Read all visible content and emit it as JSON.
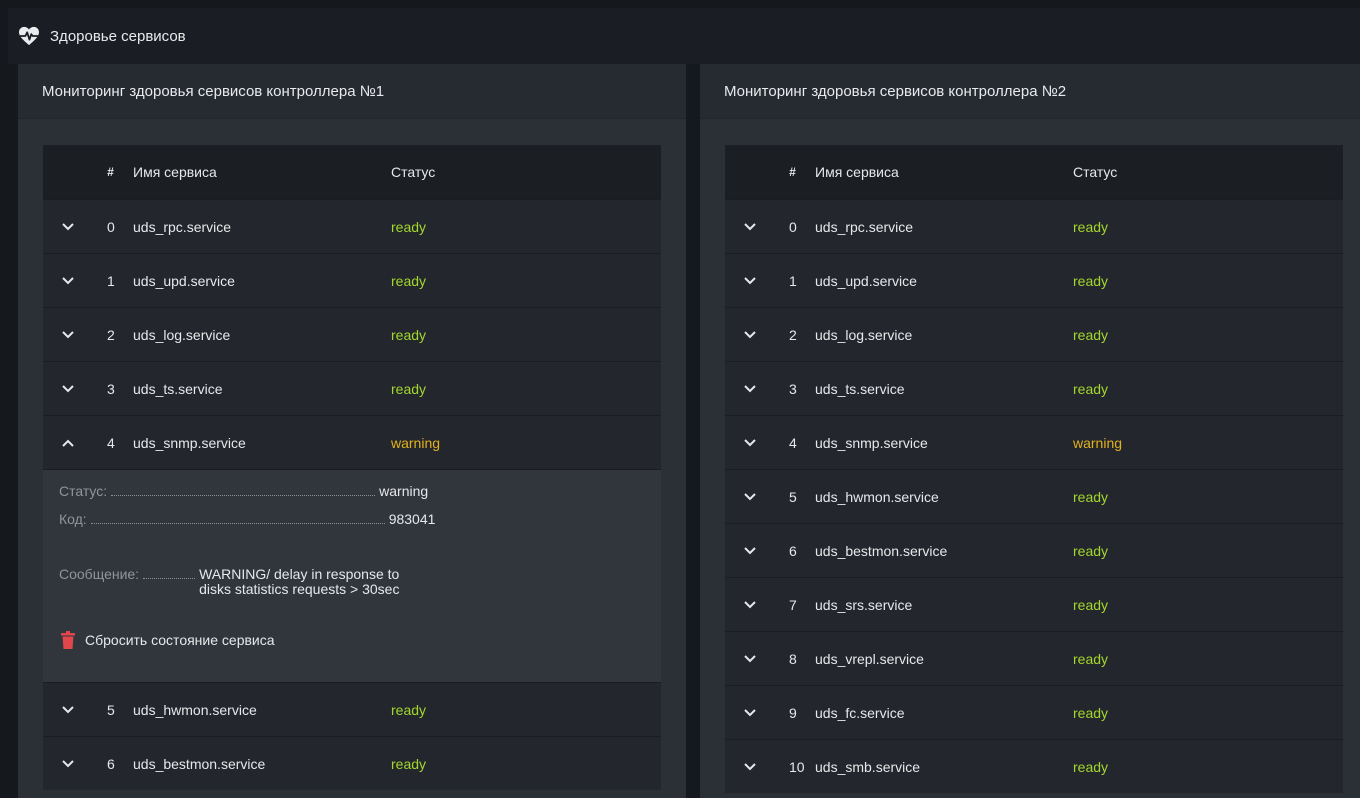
{
  "header": {
    "title": "Здоровье сервисов",
    "icon": "heart-pulse-icon"
  },
  "columns": {
    "num": "#",
    "name": "Имя сервиса",
    "status": "Статус"
  },
  "colors": {
    "ready": "#a3d62e",
    "warning": "#e3b21b",
    "reset_icon": "#e0464a"
  },
  "panel1": {
    "title": "Мониторинг здоровья сервисов контроллера №1",
    "rows_before": [
      {
        "num": "0",
        "name": "uds_rpc.service",
        "status": "ready"
      },
      {
        "num": "1",
        "name": "uds_upd.service",
        "status": "ready"
      },
      {
        "num": "2",
        "name": "uds_log.service",
        "status": "ready"
      },
      {
        "num": "3",
        "name": "uds_ts.service",
        "status": "ready"
      }
    ],
    "expanded_row": {
      "num": "4",
      "name": "uds_snmp.service",
      "status": "warning"
    },
    "details": {
      "status_label": "Статус:",
      "status_value": "warning",
      "code_label": "Код:",
      "code_value": "983041",
      "message_label": "Сообщение:",
      "message_line1": "WARNING/ delay in response to",
      "message_line2": "disks statistics requests > 30sec",
      "reset_label": "Сбросить состояние сервиса"
    },
    "rows_after": [
      {
        "num": "5",
        "name": "uds_hwmon.service",
        "status": "ready"
      },
      {
        "num": "6",
        "name": "uds_bestmon.service",
        "status": "ready"
      }
    ]
  },
  "panel2": {
    "title": "Мониторинг здоровья сервисов контроллера №2",
    "rows": [
      {
        "num": "0",
        "name": "uds_rpc.service",
        "status": "ready"
      },
      {
        "num": "1",
        "name": "uds_upd.service",
        "status": "ready"
      },
      {
        "num": "2",
        "name": "uds_log.service",
        "status": "ready"
      },
      {
        "num": "3",
        "name": "uds_ts.service",
        "status": "ready"
      },
      {
        "num": "4",
        "name": "uds_snmp.service",
        "status": "warning"
      },
      {
        "num": "5",
        "name": "uds_hwmon.service",
        "status": "ready"
      },
      {
        "num": "6",
        "name": "uds_bestmon.service",
        "status": "ready"
      },
      {
        "num": "7",
        "name": "uds_srs.service",
        "status": "ready"
      },
      {
        "num": "8",
        "name": "uds_vrepl.service",
        "status": "ready"
      },
      {
        "num": "9",
        "name": "uds_fc.service",
        "status": "ready"
      },
      {
        "num": "10",
        "name": "uds_smb.service",
        "status": "ready"
      }
    ]
  }
}
